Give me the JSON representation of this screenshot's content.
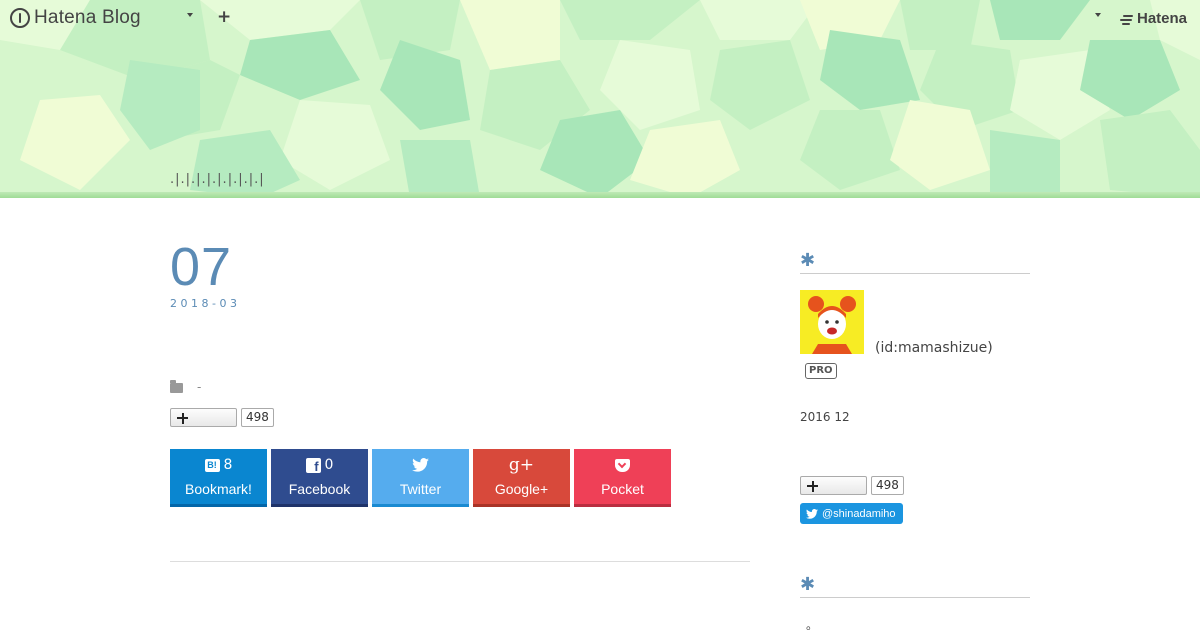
{
  "topbar": {
    "logo_text": "Hatena Blog",
    "brand_text": "Hatena"
  },
  "header": {
    "blog_title": ".|.|.|.|.|.|.|.|.|"
  },
  "entry": {
    "day": "07",
    "year_month": "2018-03",
    "category": "-",
    "bookmark_count": "498",
    "share": {
      "hatena_count": "8",
      "hatena_label": "Bookmark!",
      "facebook_count": "0",
      "facebook_label": "Facebook",
      "twitter_label": "Twitter",
      "googleplus_label": "Google+",
      "pocket_label": "Pocket"
    }
  },
  "sidebar": {
    "profile_star": "✱",
    "user_id": "(id:mamashizue)",
    "pro_badge": "PRO",
    "since": "2016 12",
    "bookmark_count": "498",
    "twitter_follow": "@shinadamiho",
    "second_star": "✱",
    "second_text": "。"
  },
  "colors": {
    "accent_blue": "#5b8bb5",
    "hatena": "#0a86d0",
    "facebook": "#2f4c8f",
    "twitter": "#55acee",
    "googleplus": "#d8493b",
    "pocket": "#ef4057"
  }
}
